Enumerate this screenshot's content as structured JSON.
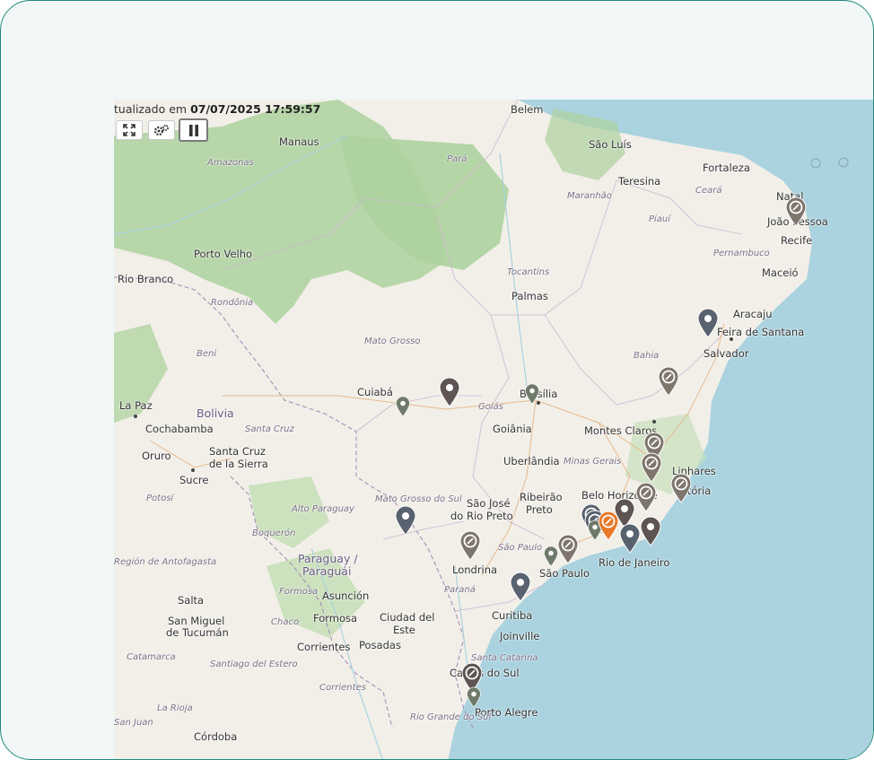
{
  "status": {
    "prefix": "tualizado em",
    "timestamp": "07/07/2025 17:59:57"
  },
  "controls": {
    "fullscreen_icon": "expand-arrows-icon",
    "settings_icon": "gears-icon",
    "pause_icon": "pause-icon"
  },
  "colors": {
    "frame_border": "#1f8a7a",
    "frame_bg": "#f1f7f7",
    "ocean": "#aad3df",
    "land": "#f2efe9",
    "forest": "#add19e",
    "marker_dark": "#5d5453",
    "marker_slate": "#59636f",
    "marker_taupe": "#7e756d",
    "marker_olive": "#6f7a68",
    "marker_orange": "#e8792a"
  },
  "labels": {
    "cities": [
      "Belem",
      "São Luís",
      "Manaus",
      "Fortaleza",
      "Teresina",
      "Natal",
      "João Pessoa",
      "Recife",
      "Porto Velho",
      "Maceió",
      "Rio Branco",
      "Palmas",
      "Aracaju",
      "Feira de Santana",
      "Salvador",
      "Cuiabá",
      "Brasília",
      "La Paz",
      "Cochabamba",
      "Goiânia",
      "Montes Claros",
      "Oruro",
      "Santa Cruz",
      "de la Sierra",
      "Uberlândia",
      "Sucre",
      "Linhares",
      "Vitória",
      "Ribeirão",
      "Preto",
      "Belo Horizonte",
      "São José",
      "do Rio Preto",
      "Paraguay /",
      "Paraguái",
      "São Paulo",
      "Rio de Janeiro",
      "Londrina",
      "Salta",
      "Asunción",
      "Curitiba",
      "San Miguel",
      "de Tucumán",
      "Formosa",
      "Ciudad del",
      "Este",
      "Joinville",
      "Corrientes",
      "Posadas",
      "Caxias do Sul",
      "Porto Alegre",
      "Córdoba"
    ],
    "regions": [
      "Amazonas",
      "Pará",
      "Maranhão",
      "Ceará",
      "Piauí",
      "Pernambuco",
      "Rondônia",
      "Tocantins",
      "Mato Grosso",
      "Bahia",
      "Beni",
      "Goiás",
      "Minas Gerais",
      "Santa Cruz",
      "Mato Grosso do Sul",
      "Potosí",
      "Alto Paraguay",
      "Boquerón",
      "Región de Antofagasta",
      "São Paulo",
      "Formosa",
      "Paraná",
      "Chaco",
      "Santiago del Estero",
      "Santa Catarina",
      "Catamarca",
      "Corrientes",
      "La Rioja",
      "Rio Grande do Sul",
      "San Juan"
    ],
    "countries": [
      "Bolivia",
      "Paraguay / Paraguái"
    ]
  }
}
